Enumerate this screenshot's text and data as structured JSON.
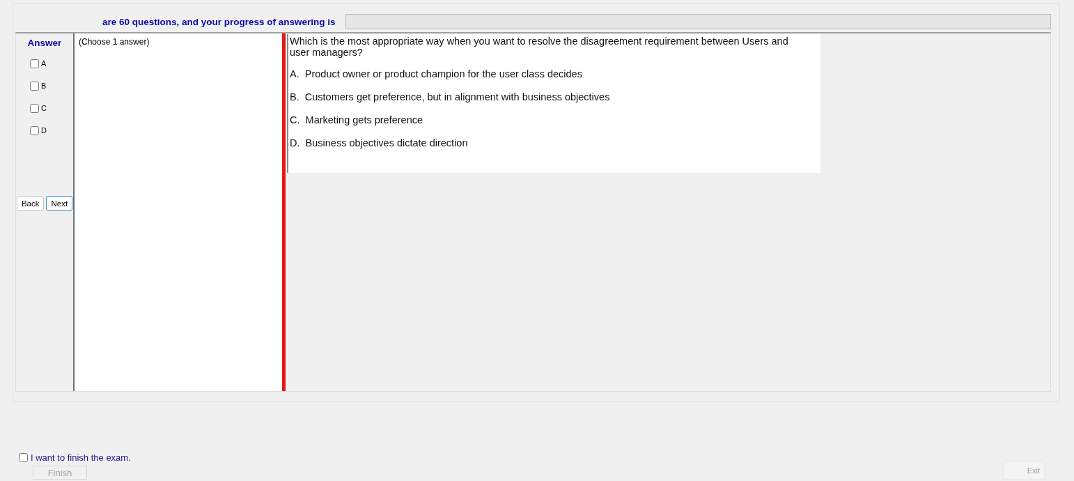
{
  "progress": {
    "label": "are 60 questions, and your progress of answering is",
    "level": 0
  },
  "answer": {
    "title": "Answer",
    "options": [
      {
        "label": "A",
        "checked": false
      },
      {
        "label": "B",
        "checked": false
      },
      {
        "label": "C",
        "checked": false
      },
      {
        "label": "D",
        "checked": false
      }
    ],
    "buttons": [
      {
        "label": "Back",
        "focused": false
      },
      {
        "label": "Next",
        "focused": true
      }
    ]
  },
  "instruction": "(Choose 1 answer)",
  "question": {
    "text": "Which is the most appropriate way when you want to resolve the disagreement requirement between Users and user managers?",
    "choices": [
      {
        "letter": "A.",
        "text": "Product owner or product champion for the user class decides"
      },
      {
        "letter": "B.",
        "text": "Customers get preference, but in alignment with business objectives"
      },
      {
        "letter": "C.",
        "text": "Marketing gets preference"
      },
      {
        "letter": "D.",
        "text": "Business objectives dictate direction"
      }
    ]
  },
  "finish": {
    "label": "I want to finish the exam.",
    "checked": false,
    "button": "Finish",
    "button_disabled": true
  },
  "exit": {
    "label": "Exit",
    "disabled": true
  }
}
